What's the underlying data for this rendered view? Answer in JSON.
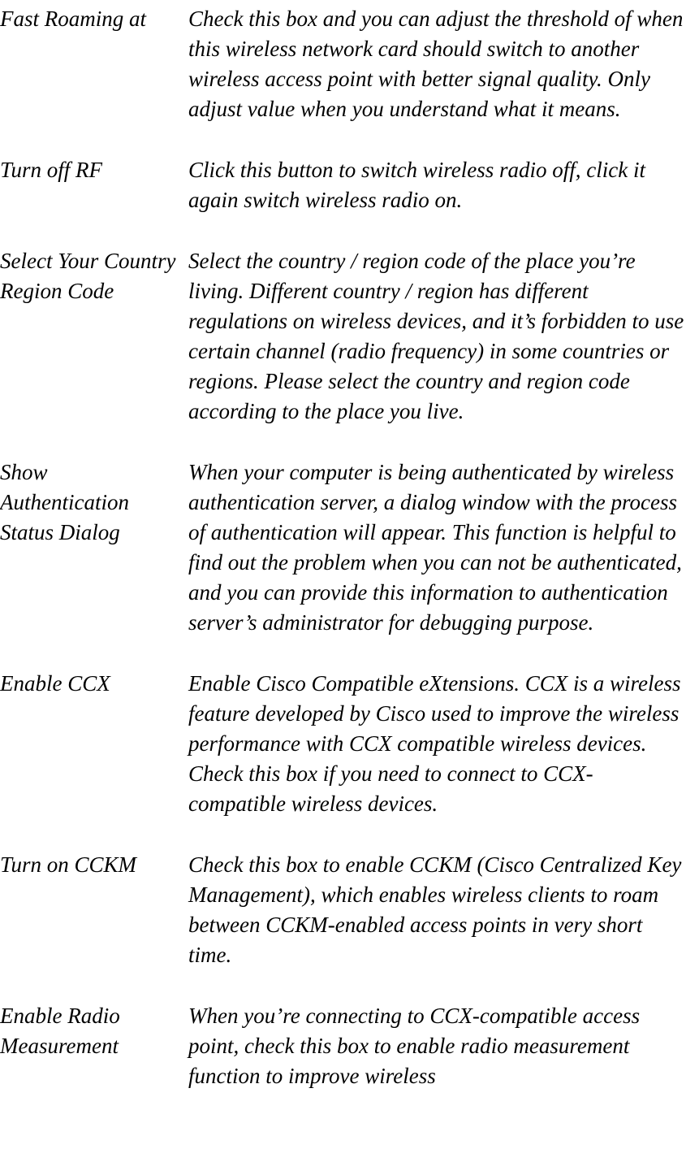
{
  "rows": [
    {
      "term": "Fast Roaming at",
      "desc": "Check this box and you can adjust the threshold of when this wireless network card should switch to another wireless access point with better signal quality. Only adjust value when you understand what it means."
    },
    {
      "term": "Turn off RF",
      "desc": "Click this button to switch wireless radio off, click it again switch wireless radio on."
    },
    {
      "term": "Select Your Country Region Code",
      "desc": "Select the country / region code of the place you’re living. Different country / region has different regulations on wireless devices, and it’s forbidden to use certain channel (radio frequency) in some countries or regions. Please select the country and region code according to the place you live."
    },
    {
      "term": "Show Authentication Status Dialog",
      "desc": "When your computer is being authenticated by wireless authentication server, a dialog window with the process of authentication will appear. This function is helpful to find out the problem when you can not be authenticated, and you can provide this information to authentication server’s administrator for debugging purpose."
    },
    {
      "term": "Enable CCX",
      "desc": "Enable Cisco Compatible eXtensions. CCX is a wireless feature developed by Cisco used to improve the wireless performance with CCX compatible wireless devices. Check this box if you need to connect to CCX-compatible wireless devices."
    },
    {
      "term": "Turn on CCKM",
      "desc": "Check this box to enable CCKM (Cisco Centralized Key Management), which enables wireless clients to roam between CCKM-enabled access points in very short time."
    },
    {
      "term": "Enable Radio Measurement",
      "desc": "When you’re connecting to CCX-compatible access point, check this box to enable radio measurement function to improve wireless"
    }
  ]
}
